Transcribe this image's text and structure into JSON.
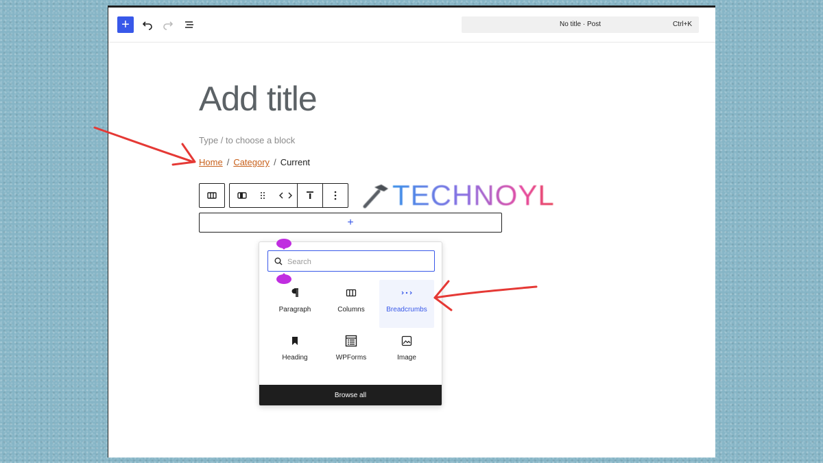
{
  "topbar": {
    "add_label": "+",
    "document_title": "No title · Post",
    "shortcut": "Ctrl+K"
  },
  "editor": {
    "title_placeholder": "Add title",
    "block_hint": "Type / to choose a block",
    "breadcrumbs": {
      "home": "Home",
      "separator": "/",
      "category": "Category",
      "current": "Current"
    },
    "appender_label": "+"
  },
  "watermark": {
    "text": "TECHNOYL"
  },
  "inserter": {
    "search_placeholder": "Search",
    "blocks": [
      {
        "label": "Paragraph",
        "icon": "paragraph-icon"
      },
      {
        "label": "Columns",
        "icon": "columns-icon"
      },
      {
        "label": "Breadcrumbs",
        "icon": "breadcrumbs-icon",
        "selected": true
      },
      {
        "label": "Heading",
        "icon": "heading-icon"
      },
      {
        "label": "WPForms",
        "icon": "wpforms-icon"
      },
      {
        "label": "Image",
        "icon": "image-icon"
      }
    ],
    "browse_all_label": "Browse all"
  },
  "colors": {
    "accent": "#3858e9",
    "link": "#c8601b",
    "annotation_arrow": "#e53935",
    "selection_handle": "#c02ee0"
  }
}
